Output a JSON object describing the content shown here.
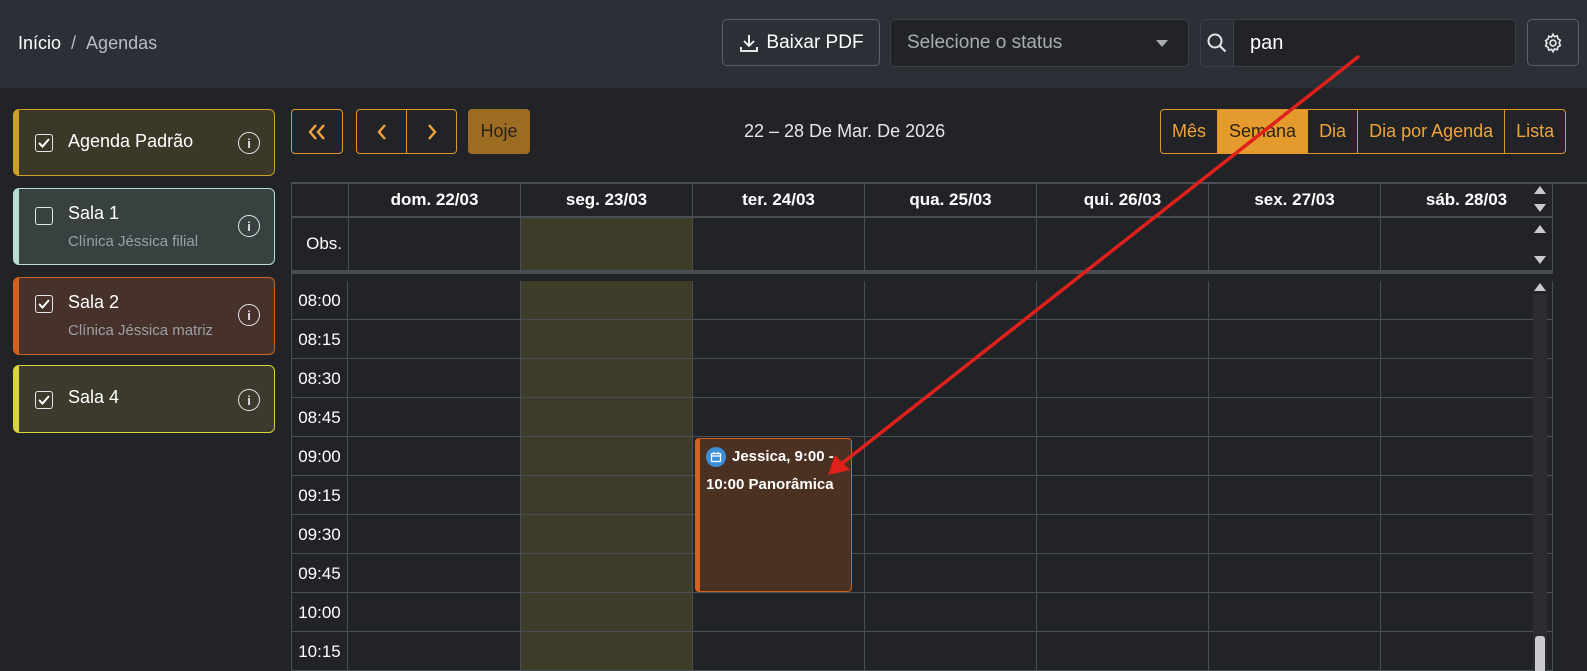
{
  "breadcrumb": {
    "home": "Início",
    "separator": "/",
    "current": "Agendas"
  },
  "toolbar": {
    "pdf_label": "Baixar PDF",
    "status_placeholder": "Selecione o status",
    "search_value": "pan"
  },
  "agendas": [
    {
      "name": "Agenda Padrão",
      "subtitle": "",
      "checked": true,
      "color": "#c9a227"
    },
    {
      "name": "Sala 1",
      "subtitle": "Clínica Jéssica filial",
      "checked": false,
      "color": "#b9ddd0"
    },
    {
      "name": "Sala 2",
      "subtitle": "Clínica Jéssica matriz",
      "checked": true,
      "color": "#d1631f"
    },
    {
      "name": "Sala 4",
      "subtitle": "",
      "checked": true,
      "color": "#d8d43a"
    }
  ],
  "calendar": {
    "today_label": "Hoje",
    "range_title": "22 – 28 De Mar. De 2026",
    "views": [
      "Mês",
      "Semana",
      "Dia",
      "Dia por Agenda",
      "Lista"
    ],
    "active_view": "Semana",
    "days": [
      "dom. 22/03",
      "seg. 23/03",
      "ter. 24/03",
      "qua. 25/03",
      "qui. 26/03",
      "sex. 27/03",
      "sáb. 28/03"
    ],
    "obs_label": "Obs.",
    "times": [
      "08:00",
      "08:15",
      "08:30",
      "08:45",
      "09:00",
      "09:15",
      "09:30",
      "09:45",
      "10:00",
      "10:15"
    ],
    "event": {
      "line1": "Jessica, 9:00 -",
      "line2": "10:00 Panorâmica"
    }
  },
  "colors": {
    "accent": "#e49a2c",
    "event_border": "#d1631f",
    "highlight_day": "#3e3d2a"
  }
}
